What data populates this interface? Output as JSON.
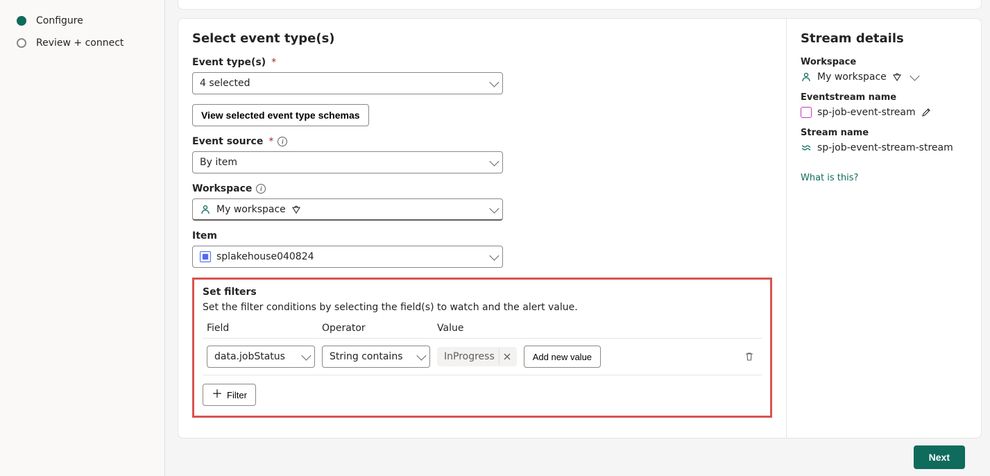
{
  "steps": {
    "configure": "Configure",
    "review": "Review + connect"
  },
  "section": {
    "title": "Select event type(s)",
    "event_types_label": "Event type(s)",
    "event_types_value": "4 selected",
    "view_schemas_btn": "View selected event type schemas",
    "event_source_label": "Event source",
    "event_source_value": "By item",
    "workspace_label": "Workspace",
    "workspace_value": "My workspace",
    "item_label": "Item",
    "item_value": "splakehouse040824"
  },
  "filters": {
    "title": "Set filters",
    "description": "Set the filter conditions by selecting the field(s) to watch and the alert value.",
    "col_field": "Field",
    "col_operator": "Operator",
    "col_value": "Value",
    "row": {
      "field": "data.jobStatus",
      "operator": "String contains",
      "value": "InProgress"
    },
    "add_value_btn": "Add new value",
    "add_filter_btn": "Filter"
  },
  "details": {
    "title": "Stream details",
    "workspace_label": "Workspace",
    "workspace_value": "My workspace",
    "eventstream_label": "Eventstream name",
    "eventstream_value": "sp-job-event-stream",
    "streamname_label": "Stream name",
    "streamname_value": "sp-job-event-stream-stream",
    "what_is_this": "What is this?"
  },
  "footer": {
    "next": "Next"
  }
}
